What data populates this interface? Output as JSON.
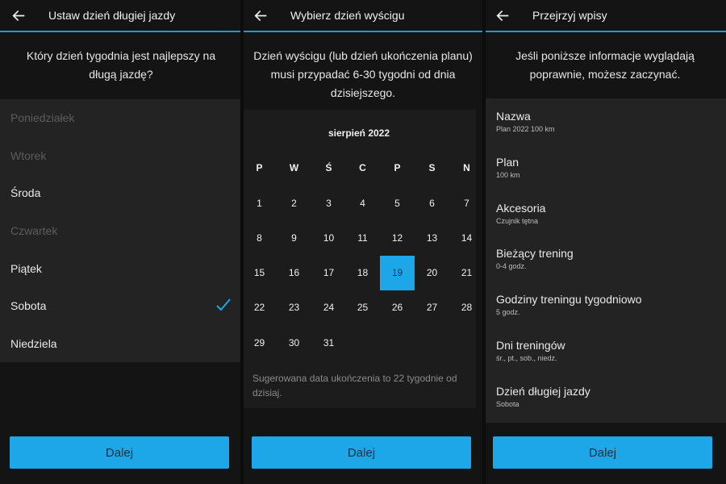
{
  "panel1": {
    "title": "Ustaw dzień długiej jazdy",
    "prompt": "Który dzień tygodnia jest najlepszy na długą jazdę?",
    "days": [
      {
        "label": "Poniedziałek",
        "enabled": false,
        "checked": false
      },
      {
        "label": "Wtorek",
        "enabled": false,
        "checked": false
      },
      {
        "label": "Środa",
        "enabled": true,
        "checked": false
      },
      {
        "label": "Czwartek",
        "enabled": false,
        "checked": false
      },
      {
        "label": "Piątek",
        "enabled": true,
        "checked": false
      },
      {
        "label": "Sobota",
        "enabled": true,
        "checked": true
      },
      {
        "label": "Niedziela",
        "enabled": true,
        "checked": false
      }
    ],
    "next_label": "Dalej"
  },
  "panel2": {
    "title": "Wybierz dzień wyścigu",
    "prompt": "Dzień wyścigu (lub dzień ukończenia planu) musi przypadać 6-30 tygodni od dnia dzisiejszego.",
    "month": "sierpień 2022",
    "weekdays": [
      "P",
      "W",
      "Ś",
      "C",
      "P",
      "S",
      "N"
    ],
    "weeks": [
      [
        "1",
        "2",
        "3",
        "4",
        "5",
        "6",
        "7"
      ],
      [
        "8",
        "9",
        "10",
        "11",
        "12",
        "13",
        "14"
      ],
      [
        "15",
        "16",
        "17",
        "18",
        "19",
        "20",
        "21"
      ],
      [
        "22",
        "23",
        "24",
        "25",
        "26",
        "27",
        "28"
      ],
      [
        "29",
        "30",
        "31",
        "",
        "",
        "",
        ""
      ]
    ],
    "selected_day": "19",
    "suggestion": "Sugerowana data ukończenia to 22 tygodnie od dzisiaj.",
    "next_label": "Dalej"
  },
  "panel3": {
    "title": "Przejrzyj wpisy",
    "prompt": "Jeśli poniższe informacje wyglądają poprawnie, możesz zaczynać.",
    "entries": [
      {
        "label": "Nazwa",
        "value": "Plan 2022 100 km"
      },
      {
        "label": "Plan",
        "value": "100 km"
      },
      {
        "label": "Akcesoria",
        "value": "Czujnik tętna"
      },
      {
        "label": "Bieżący trening",
        "value": "0-4 godz."
      },
      {
        "label": "Godziny treningu tygodniowo",
        "value": "5 godz."
      },
      {
        "label": "Dni treningów",
        "value": "śr., pt., sob., niedz."
      },
      {
        "label": "Dzień długiej jazdy",
        "value": "Sobota"
      }
    ],
    "next_label": "Dalej"
  },
  "colors": {
    "accent": "#1ea7e8",
    "background": "#141414",
    "list_bg": "#232323"
  },
  "icons": {
    "back": "arrow-left-icon",
    "check": "checkmark-icon"
  }
}
